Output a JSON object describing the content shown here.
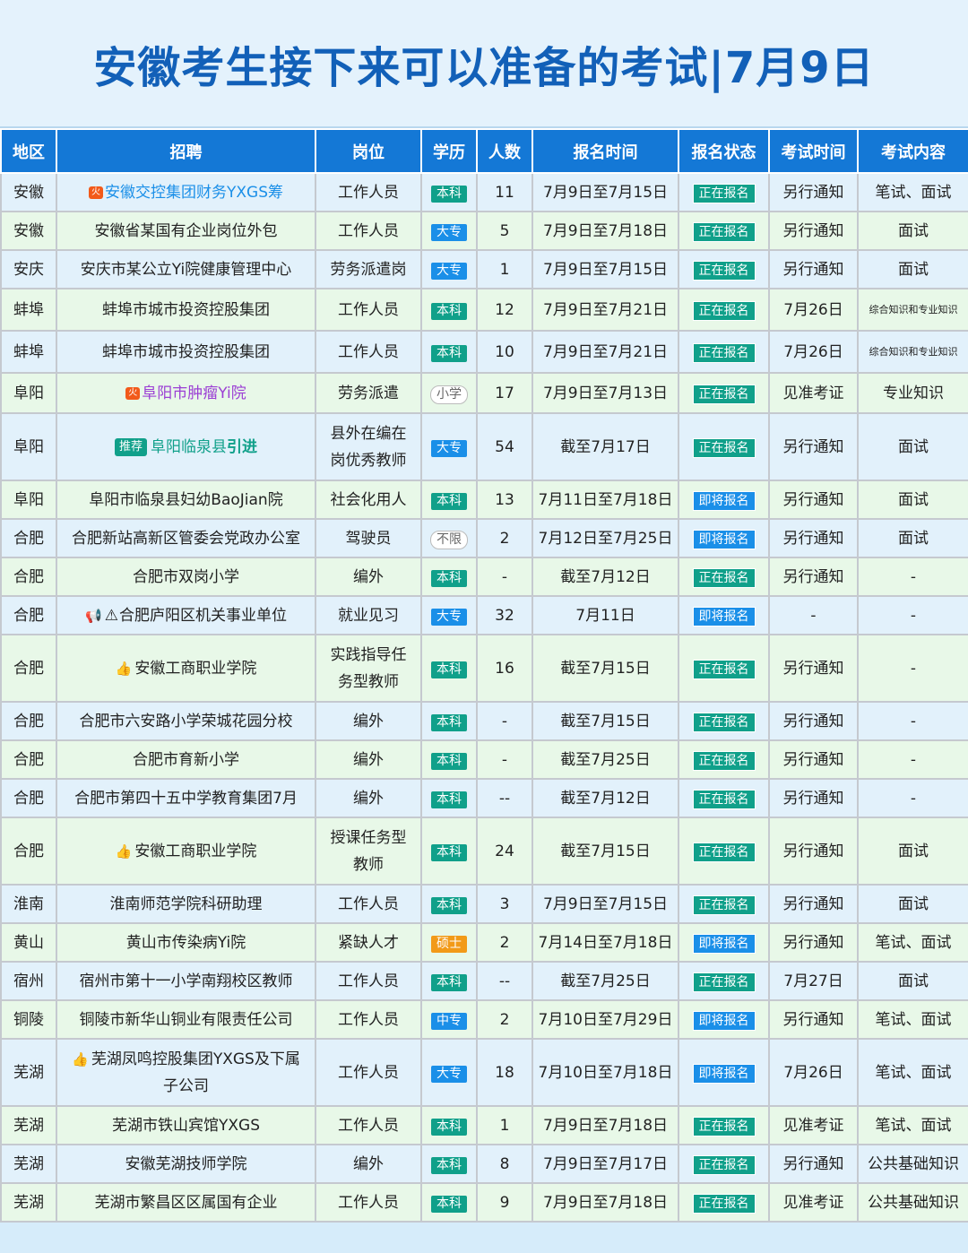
{
  "title": "安徽考生接下来可以准备的考试|7月9日",
  "headers": [
    "地区",
    "招聘",
    "岗位",
    "学历",
    "人数",
    "报名时间",
    "报名状态",
    "考试时间",
    "考试内容"
  ],
  "icons": {
    "fire_tag": "火",
    "recommend_tag": "推荐",
    "thumb_icon": "👍",
    "horn_icon": "📢",
    "warning_icon": "⚠"
  },
  "rows": [
    {
      "region": "安徽",
      "recruit": "安徽交控集团财务YXGS筹",
      "post": "工作人员",
      "edu": "本科",
      "count": "11",
      "reg_time": "7月9日至7月15日",
      "status": "正在报名",
      "exam_time": "另行通知",
      "content": "笔试、面试"
    },
    {
      "region": "安徽",
      "recruit": "安徽省某国有企业岗位外包",
      "post": "工作人员",
      "edu": "大专",
      "count": "5",
      "reg_time": "7月9日至7月18日",
      "status": "正在报名",
      "exam_time": "另行通知",
      "content": "面试"
    },
    {
      "region": "安庆",
      "recruit": "安庆市某公立Yi院健康管理中心",
      "post": "劳务派遣岗",
      "edu": "大专",
      "count": "1",
      "reg_time": "7月9日至7月15日",
      "status": "正在报名",
      "exam_time": "另行通知",
      "content": "面试"
    },
    {
      "region": "蚌埠",
      "recruit": "蚌埠市城市投资控股集团",
      "post": "工作人员",
      "edu": "本科",
      "count": "12",
      "reg_time": "7月9日至7月21日",
      "status": "正在报名",
      "exam_time": "7月26日",
      "content": "综合知识和专业知识"
    },
    {
      "region": "蚌埠",
      "recruit": "蚌埠市城市投资控股集团",
      "post": "工作人员",
      "edu": "本科",
      "count": "10",
      "reg_time": "7月9日至7月21日",
      "status": "正在报名",
      "exam_time": "7月26日",
      "content": "综合知识和专业知识"
    },
    {
      "region": "阜阳",
      "recruit": "阜阳市肿瘤Yi院",
      "post": "劳务派遣",
      "edu": "小学",
      "count": "17",
      "reg_time": "7月9日至7月13日",
      "status": "正在报名",
      "exam_time": "见准考证",
      "content": "专业知识"
    },
    {
      "region": "阜阳",
      "recruit_a": "阜阳临泉县",
      "recruit_b": "引进",
      "post_l1": "县外在编在",
      "post_l2": "岗优秀教师",
      "edu": "大专",
      "count": "54",
      "reg_time": "截至7月17日",
      "status": "正在报名",
      "exam_time": "另行通知",
      "content": "面试"
    },
    {
      "region": "阜阳",
      "recruit": "阜阳市临泉县妇幼BaoJian院",
      "post": "社会化用人",
      "edu": "本科",
      "count": "13",
      "reg_time": "7月11日至7月18日",
      "status": "即将报名",
      "exam_time": "另行通知",
      "content": "面试"
    },
    {
      "region": "合肥",
      "recruit": "合肥新站高新区管委会党政办公室",
      "post": "驾驶员",
      "edu": "不限",
      "count": "2",
      "reg_time": "7月12日至7月25日",
      "status": "即将报名",
      "exam_time": "另行通知",
      "content": "面试"
    },
    {
      "region": "合肥",
      "recruit": "合肥市双岗小学",
      "post": "编外",
      "edu": "本科",
      "count": "-",
      "reg_time": "截至7月12日",
      "status": "正在报名",
      "exam_time": "另行通知",
      "content": "-"
    },
    {
      "region": "合肥",
      "recruit": "合肥庐阳区机关事业单位",
      "post": "就业见习",
      "edu": "大专",
      "count": "32",
      "reg_time": "7月11日",
      "status": "即将报名",
      "exam_time": "-",
      "content": "-"
    },
    {
      "region": "合肥",
      "recruit": "安徽工商职业学院",
      "post_l1": "实践指导任",
      "post_l2": "务型教师",
      "edu": "本科",
      "count": "16",
      "reg_time": "截至7月15日",
      "status": "正在报名",
      "exam_time": "另行通知",
      "content": "-"
    },
    {
      "region": "合肥",
      "recruit": "合肥市六安路小学荣城花园分校",
      "post": "编外",
      "edu": "本科",
      "count": "-",
      "reg_time": "截至7月15日",
      "status": "正在报名",
      "exam_time": "另行通知",
      "content": "-"
    },
    {
      "region": "合肥",
      "recruit": "合肥市育新小学",
      "post": "编外",
      "edu": "本科",
      "count": "-",
      "reg_time": "截至7月25日",
      "status": "正在报名",
      "exam_time": "另行通知",
      "content": "-"
    },
    {
      "region": "合肥",
      "recruit": "合肥市第四十五中学教育集团7月",
      "post": "编外",
      "edu": "本科",
      "count": "--",
      "reg_time": "截至7月12日",
      "status": "正在报名",
      "exam_time": "另行通知",
      "content": "-"
    },
    {
      "region": "合肥",
      "recruit": "安徽工商职业学院",
      "post_l1": "授课任务型",
      "post_l2": "教师",
      "edu": "本科",
      "count": "24",
      "reg_time": "截至7月15日",
      "status": "正在报名",
      "exam_time": "另行通知",
      "content": "面试"
    },
    {
      "region": "淮南",
      "recruit": "淮南师范学院科研助理",
      "post": "工作人员",
      "edu": "本科",
      "count": "3",
      "reg_time": "7月9日至7月15日",
      "status": "正在报名",
      "exam_time": "另行通知",
      "content": "面试"
    },
    {
      "region": "黄山",
      "recruit": "黄山市传染病Yi院",
      "post": "紧缺人才",
      "edu": "硕士",
      "count": "2",
      "reg_time": "7月14日至7月18日",
      "status": "即将报名",
      "exam_time": "另行通知",
      "content": "笔试、面试"
    },
    {
      "region": "宿州",
      "recruit": "宿州市第十一小学南翔校区教师",
      "post": "工作人员",
      "edu": "本科",
      "count": "--",
      "reg_time": "截至7月25日",
      "status": "正在报名",
      "exam_time": "7月27日",
      "content": "面试"
    },
    {
      "region": "铜陵",
      "recruit": "铜陵市新华山铜业有限责任公司",
      "post": "工作人员",
      "edu": "中专",
      "count": "2",
      "reg_time": "7月10日至7月29日",
      "status": "即将报名",
      "exam_time": "另行通知",
      "content": "笔试、面试"
    },
    {
      "region": "芜湖",
      "recruit_l1": "芜湖凤鸣控股集团YXGS及下属",
      "recruit_l2": "子公司",
      "post": "工作人员",
      "edu": "大专",
      "count": "18",
      "reg_time": "7月10日至7月18日",
      "status": "即将报名",
      "exam_time": "7月26日",
      "content": "笔试、面试"
    },
    {
      "region": "芜湖",
      "recruit": "芜湖市铁山宾馆YXGS",
      "post": "工作人员",
      "edu": "本科",
      "count": "1",
      "reg_time": "7月9日至7月18日",
      "status": "正在报名",
      "exam_time": "见准考证",
      "content": "笔试、面试"
    },
    {
      "region": "芜湖",
      "recruit": "安徽芜湖技师学院",
      "post": "编外",
      "edu": "本科",
      "count": "8",
      "reg_time": "7月9日至7月17日",
      "status": "正在报名",
      "exam_time": "另行通知",
      "content": "公共基础知识"
    },
    {
      "region": "芜湖",
      "recruit": "芜湖市繁昌区区属国有企业",
      "post": "工作人员",
      "edu": "本科",
      "count": "9",
      "reg_time": "7月9日至7月18日",
      "status": "正在报名",
      "exam_time": "见准考证",
      "content": "公共基础知识"
    }
  ]
}
